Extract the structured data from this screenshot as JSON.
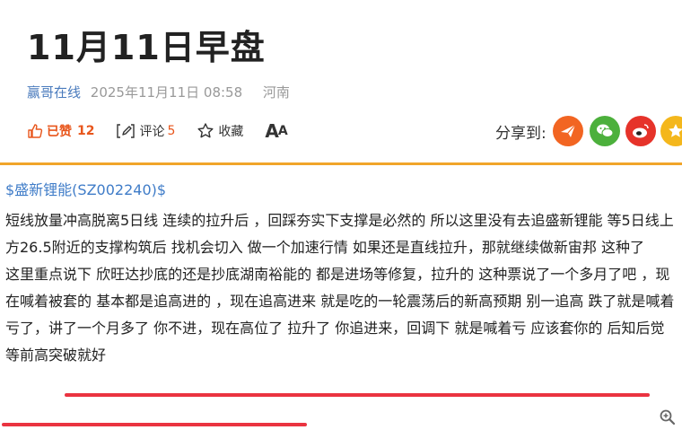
{
  "article": {
    "title": "11月11日早盘",
    "author": "赢哥在线",
    "datetime": "2025年11月11日 08:58",
    "location": "河南"
  },
  "actions": {
    "like_label": "已赞",
    "like_count": "12",
    "comment_label": "评论",
    "comment_count": "5",
    "favorite_label": "收藏",
    "font_size_label": "A",
    "font_size_label_small": "A"
  },
  "share": {
    "label": "分享到:",
    "icons": [
      "paper-plane-icon",
      "wechat-icon",
      "weibo-icon",
      "qzone-star-icon"
    ]
  },
  "content": {
    "stock_tag": "$盛新锂能(SZ002240)$",
    "paragraph_1": "短线放量冲高脱离5日线 连续的拉升后 ，回踩夯实下支撑是必然的 所以这里没有去追盛新锂能 等5日线上方26.5附近的支撑构筑后 找机会切入 做一个加速行情 如果还是直线拉升，那就继续做新宙邦 这种了",
    "paragraph_2": "这里重点说下 欣旺达抄底的还是抄底湖南裕能的 都是进场等修复，拉升的 这种票说了一个多月了吧 ，现在喊着被套的 基本都是追高进的 ，现在追高进来 就是吃的一轮震荡后的新高预期 别一追高 跌了就是喊着亏了，讲了一个月多了 你不进，现在高位了 拉升了 你追进来，回调下 就是喊着亏 应该套你的 后知后觉 等前高突破就好"
  },
  "colors": {
    "accent_orange": "#e8561c",
    "divider": "#f1a52a",
    "link_blue": "#3f7cc8",
    "underline_red": "#ea3340"
  }
}
